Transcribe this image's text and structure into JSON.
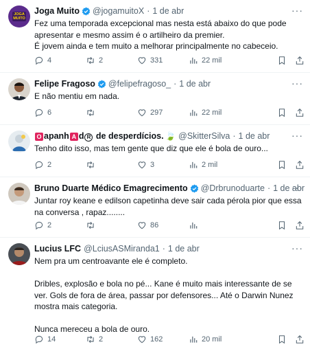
{
  "colors": {
    "accent": "#1d9bf0",
    "muted": "#536471",
    "text": "#0f1419",
    "divider": "#eff3f4"
  },
  "tweets": [
    {
      "name": "Joga Muito",
      "handle": "@jogamuitoX",
      "time": "1 de abr",
      "text": "Fez uma temporada excepcional mas nesta está abaixo do que pode apresentar e mesmo assim é o artilheiro da premier.\nÉ jovem ainda e tem muito a melhorar principalmente no cabeceio.",
      "avatar_text": "JOGA MUITO",
      "replies": "4",
      "retweets": "2",
      "likes": "331",
      "views": "22 mil"
    },
    {
      "name": "Felipe Fragoso",
      "handle": "@felipefragoso_",
      "time": "1 de abr",
      "text": "E não mentiu em nada.",
      "replies": "6",
      "retweets": "",
      "likes": "297",
      "views": "22 mil"
    },
    {
      "name_parts": {
        "b1": "O",
        "p1": "apanh",
        "b2": "A",
        "p2": "d",
        "b3": "R",
        "p3": " de desperdícios.",
        "emoji": "🍃"
      },
      "handle": "@SkitterSilva",
      "time": "1 de abr",
      "text": "Tenho dito isso, mas tem gente que diz que ele é bola de ouro...",
      "replies": "2",
      "retweets": "",
      "likes": "3",
      "views": "2 mil"
    },
    {
      "name": "Bruno Duarte Médico Emagrecimento",
      "handle": "@Drbrunoduarte",
      "time": "1 de abr",
      "text": "Juntar roy keane e edilson capetinha deve sair cada pérola pior que essa na conversa , rapaz........",
      "replies": "2",
      "retweets": "",
      "likes": "86",
      "views": ""
    },
    {
      "name": "Lucius LFC",
      "handle": "@LciusASMiranda1",
      "time": "1 de abr",
      "text": "Nem pra um centroavante ele é completo.\n\nDribles, explosão e bola no pé... Kane é muito mais interessante de se ver. Gols de fora de área, passar por defensores... Até o Darwin Nunez mostra mais categoria.\n\nNunca mereceu a bola de ouro.",
      "replies": "14",
      "retweets": "2",
      "likes": "162",
      "views": "20 mil"
    }
  ]
}
